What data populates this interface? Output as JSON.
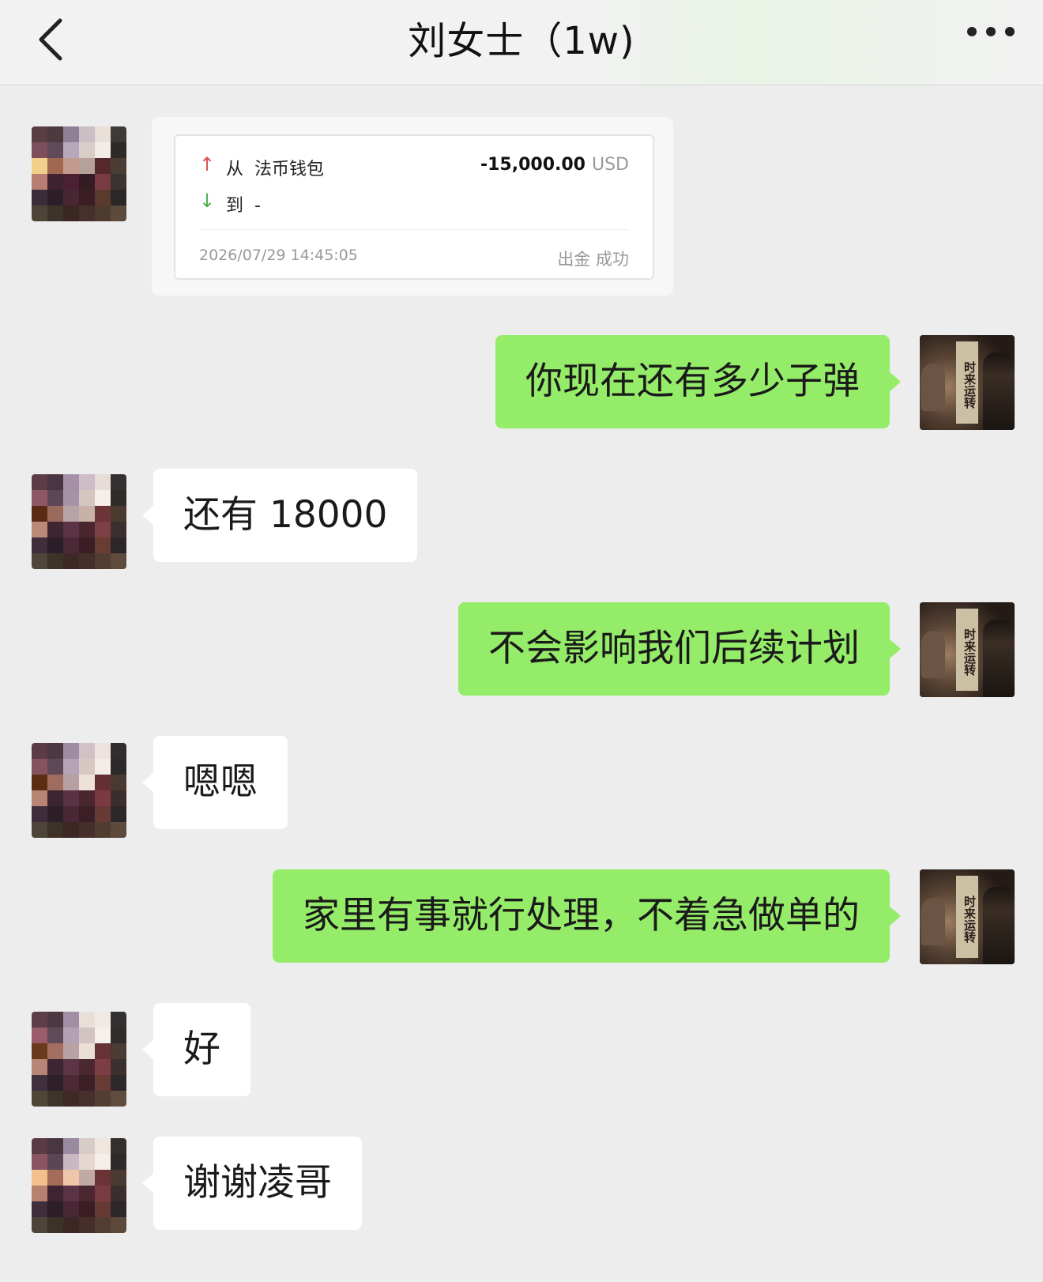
{
  "header": {
    "back_icon": "chevron-left-icon",
    "title": "刘女士（1w)",
    "more_icon": "ellipsis-icon"
  },
  "transfer_card": {
    "from_prefix": "从",
    "from_value": "法币钱包",
    "to_prefix": "到",
    "to_value": "-",
    "amount": "-15,000.00",
    "currency": "USD",
    "timestamp": "2026/07/29 14:45:05",
    "status": "出金 成功",
    "up_color": "#d9534f",
    "down_color": "#4caf50"
  },
  "messages": [
    {
      "side": "self",
      "text": "你现在还有多少子弹"
    },
    {
      "side": "other",
      "text": "还有 18000"
    },
    {
      "side": "self",
      "text": "不会影响我们后续计划"
    },
    {
      "side": "other",
      "text": "嗯嗯"
    },
    {
      "side": "self",
      "text": "家里有事就行处理，不着急做单的"
    },
    {
      "side": "other",
      "text": "好"
    },
    {
      "side": "other",
      "text": "谢谢凌哥"
    }
  ],
  "self_avatar": {
    "banner_text": "时来运转"
  },
  "colors": {
    "background": "#ededed",
    "out_bubble": "#95ec69",
    "in_bubble": "#ffffff"
  }
}
